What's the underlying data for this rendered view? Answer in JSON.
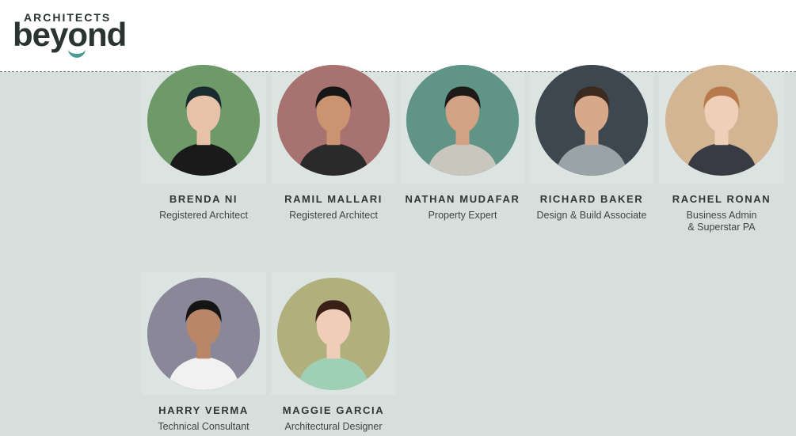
{
  "brand": {
    "logo_top": "ARCHITECTS",
    "logo_bottom": "beyond",
    "accent": "#4a9a95"
  },
  "team": [
    {
      "name": "BRENDA NI",
      "role": [
        "Registered Architect"
      ],
      "bg": "#6e9a6a",
      "skin": "#e7c2a8",
      "hair": "#1b2a2e",
      "shirt": "#1a1a1a"
    },
    {
      "name": "RAMIL MALLARI",
      "role": [
        "Registered Architect"
      ],
      "bg": "#a7726f",
      "skin": "#c9946f",
      "hair": "#161616",
      "shirt": "#2a2a2a"
    },
    {
      "name": "NATHAN MUDAFAR",
      "role": [
        "Property Expert"
      ],
      "bg": "#5f9486",
      "skin": "#d3a184",
      "hair": "#1d1a17",
      "shirt": "#c9c6be"
    },
    {
      "name": "RICHARD BAKER",
      "role": [
        "Design & Build Associate"
      ],
      "bg": "#3d474f",
      "skin": "#d8a88a",
      "hair": "#3b2a20",
      "shirt": "#9aa4a6"
    },
    {
      "name": "RACHEL RONAN",
      "role": [
        "Business Admin",
        "& Superstar PA"
      ],
      "bg": "#d2b592",
      "skin": "#efcfb8",
      "hair": "#b87a4b",
      "shirt": "#383a44"
    },
    {
      "name": "HARRY VERMA",
      "role": [
        "Technical Consultant"
      ],
      "bg": "#8a8799",
      "skin": "#b98768",
      "hair": "#151515",
      "shirt": "#f1f1f1"
    },
    {
      "name": "MAGGIE GARCIA",
      "role": [
        "Architectural Designer"
      ],
      "bg": "#b1b07d",
      "skin": "#f0cdb8",
      "hair": "#3a1f16",
      "shirt": "#9fd0b6"
    }
  ]
}
